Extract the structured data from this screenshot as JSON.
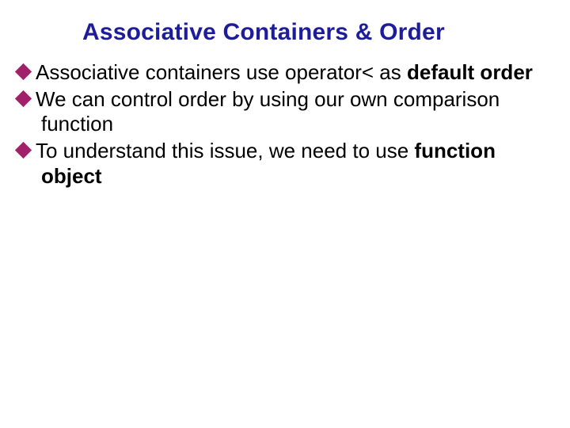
{
  "title": "Associative Containers & Order",
  "bullets": [
    {
      "pre": "Associative containers use operator< as ",
      "bold": "default order",
      "post": ""
    },
    {
      "pre": "We can control order by using our own comparison function",
      "bold": "",
      "post": ""
    },
    {
      "pre": "To understand this issue, we need to use ",
      "bold": "function object",
      "post": ""
    }
  ]
}
